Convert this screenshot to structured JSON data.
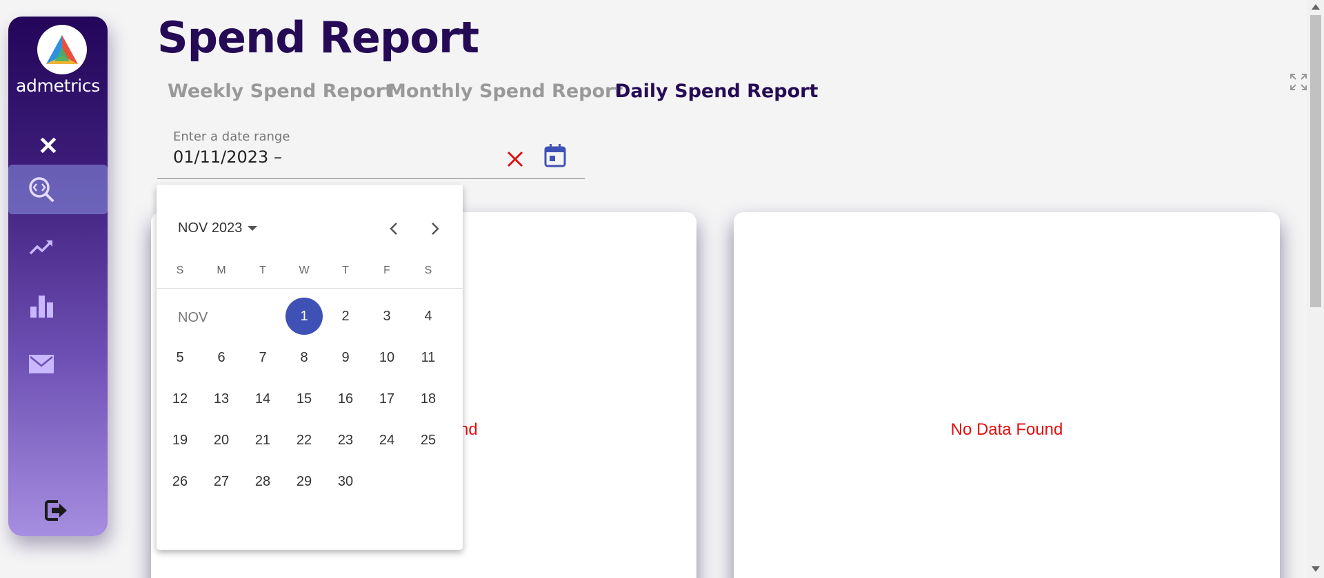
{
  "app": {
    "brand": "admetrics",
    "title": "Spend Report"
  },
  "tabs": [
    {
      "label": "Weekly Spend Report",
      "active": false
    },
    {
      "label": "Monthly Spend Report",
      "active": false
    },
    {
      "label": "Daily Spend Report",
      "active": true
    }
  ],
  "sidebar": {
    "items": [
      {
        "icon": "search-code-icon",
        "active": true
      },
      {
        "icon": "trending-up-icon",
        "active": false
      },
      {
        "icon": "bar-chart-icon",
        "active": false
      },
      {
        "icon": "mail-icon",
        "active": false
      }
    ],
    "logout_icon": "logout-icon"
  },
  "date_range": {
    "label": "Enter a date range",
    "value": "01/11/2023 –"
  },
  "calendar": {
    "period_label": "NOV 2023",
    "month_short": "NOV",
    "weekdays": [
      "S",
      "M",
      "T",
      "W",
      "T",
      "F",
      "S"
    ],
    "first_weekday_index": 3,
    "days_in_month": 30,
    "selected_day": 1
  },
  "cards": {
    "left_message": "No Data Found",
    "left_message_visible": "nd",
    "right_message": "No Data Found"
  },
  "colors": {
    "primary": "#250a55",
    "selected": "#3f51b5",
    "error": "#e01010",
    "calendar_icon": "#3f51b5"
  }
}
